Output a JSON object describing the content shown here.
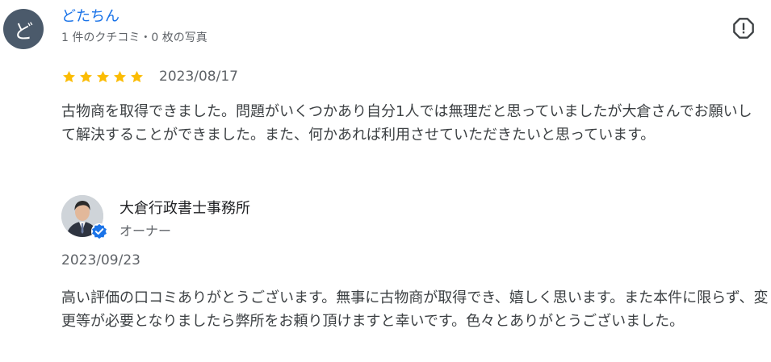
{
  "reviewer": {
    "avatar_letter": "ど",
    "avatar_color": "#4b5a6b",
    "name": "どたちん",
    "meta": "1 件のクチコミ・0 枚の写真"
  },
  "review": {
    "rating": 5,
    "star_color": "#fbbc04",
    "date": "2023/08/17",
    "text": "古物商を取得できました。問題がいくつかあり自分1人では無理だと思っていましたが大倉さんでお願いして解決することができました。また、何かあれば利用させていただきたいと思っています。"
  },
  "owner": {
    "name": "大倉行政書士事務所",
    "role": "オーナー",
    "verified_badge_color": "#1a73e8"
  },
  "reply": {
    "date": "2023/09/23",
    "text": "高い評価の口コミありがとうございます。無事に古物商が取得でき、嬉しく思います。また本件に限らず、変更等が必要となりましたら弊所をお頼り頂けますと幸いです。色々とありがとうございました。"
  },
  "icons": {
    "flag": "report-flag-icon",
    "star": "star-icon",
    "verified": "verified-check-icon"
  }
}
